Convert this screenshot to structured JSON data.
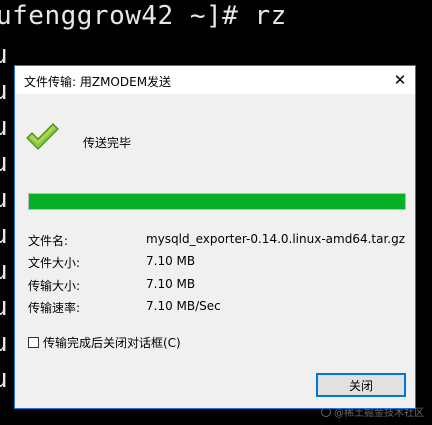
{
  "terminal": {
    "prompt": "ufenggrow42 ~]# rz",
    "line_prefix": "u"
  },
  "dialog": {
    "title": "文件传输: 用ZMODEM发送",
    "close_glyph": "✕",
    "status": "传送完毕",
    "progress_percent": 100,
    "progress_color": "#06b025",
    "info": [
      {
        "label": "文件名:",
        "value": "mysqld_exporter-0.14.0.linux-amd64.tar.gz"
      },
      {
        "label": "文件大小:",
        "value": "7.10 MB"
      },
      {
        "label": "传输大小:",
        "value": "7.10 MB"
      },
      {
        "label": "传输速率:",
        "value": "7.10 MB/Sec"
      }
    ],
    "checkbox_label": "传输完成后关闭对话框(C)",
    "checkbox_checked": false,
    "close_button_label": "关闭",
    "accent_color": "#0078d7"
  },
  "watermark": {
    "text": "@稀土掘金技术社区"
  }
}
